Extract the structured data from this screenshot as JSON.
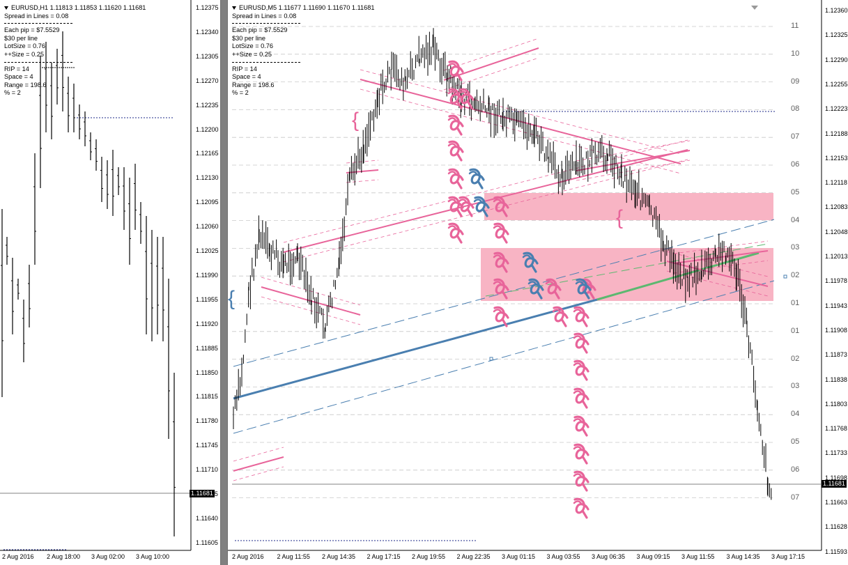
{
  "left_chart": {
    "title": "EURUSD,H1  1.11813 1.11853 1.11620 1.11681",
    "info_top": [
      "Spread in Lines = 0.08"
    ],
    "info_mid": [
      "Each pip = $7.5529",
      "$30 per line",
      "LotSize = 0.76",
      "++Size = 0.25"
    ],
    "info_bot": [
      "RIP = 14",
      "Space = 4",
      "Range = 198.6",
      "% = 2"
    ],
    "price_labels": [
      "1.12375",
      "1.12340",
      "1.12305",
      "1.12270",
      "1.12235",
      "1.12200",
      "1.12165",
      "1.12130",
      "1.12095",
      "1.12060",
      "1.12025",
      "1.11990",
      "1.11955",
      "1.11920",
      "1.11885",
      "1.11850",
      "1.11815",
      "1.11780",
      "1.11745",
      "1.11710",
      "1.11675",
      "1.11640",
      "1.11605"
    ],
    "current_price": "1.11681",
    "time_labels": [
      "2 Aug 2016",
      "2 Aug 18:00",
      "3 Aug 02:00",
      "3 Aug 10:00"
    ]
  },
  "right_chart": {
    "title": "EURUSD,M5  1.11677 1.11690 1.11670 1.11681",
    "info_top": [
      "Spread in Lines = 0.08"
    ],
    "info_mid": [
      "Each pip = $7.5529",
      "$30 per line",
      "LotSize = 0.76",
      "++Size = 0.25"
    ],
    "info_bot": [
      "RIP = 14",
      "Space = 4",
      "Range = 198.6",
      "% = 2"
    ],
    "price_labels": [
      "1.12360",
      "1.12325",
      "1.12290",
      "1.12255",
      "1.12223",
      "1.12188",
      "1.12153",
      "1.12118",
      "1.12083",
      "1.12048",
      "1.12013",
      "1.11978",
      "1.11943",
      "1.11908",
      "1.11873",
      "1.11838",
      "1.11803",
      "1.11768",
      "1.11733",
      "1.11698",
      "1.11663",
      "1.11628",
      "1.11593"
    ],
    "current_price": "1.11681",
    "level_labels": [
      "11",
      "10",
      "09",
      "08",
      "07",
      "06",
      "05",
      "04",
      "03",
      "02",
      "01",
      "01",
      "02",
      "03",
      "04",
      "05",
      "06",
      "07"
    ],
    "time_labels": [
      "2 Aug 2016",
      "2 Aug 11:55",
      "2 Aug 14:35",
      "2 Aug 17:15",
      "2 Aug 19:55",
      "2 Aug 22:35",
      "3 Aug 01:15",
      "3 Aug 03:55",
      "3 Aug 06:35",
      "3 Aug 09:15",
      "3 Aug 11:55",
      "3 Aug 14:35",
      "3 Aug 17:15"
    ]
  },
  "colors": {
    "pink": "#e8649a",
    "pink_zone": "#f8b4c4",
    "blue": "#4a7fb0",
    "green": "#5cb870",
    "grid": "#c8c8c8",
    "dotted": "#1e2a8a"
  }
}
